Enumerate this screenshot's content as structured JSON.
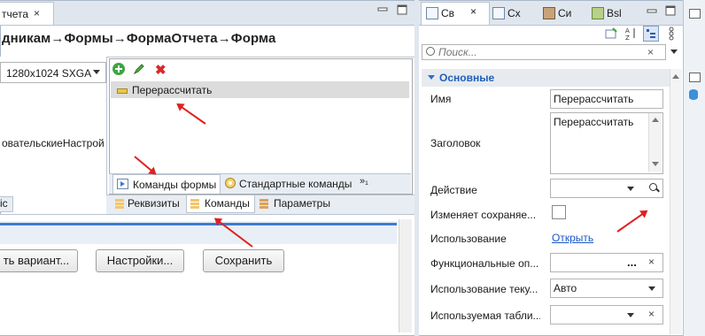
{
  "editor": {
    "tab_label": "тчета",
    "close_glyph": "×",
    "breadcrumb": "дникам→Формы→ФормаОтчета→Форма"
  },
  "preview_panel": {
    "resolution": "1280x1024 SXGA",
    "user_settings_text": "овательскиеНастрой",
    "small_tab": "іс"
  },
  "commands_panel": {
    "toolbar": {
      "add": "add-icon",
      "edit": "edit-icon",
      "delete": "✖"
    },
    "rows": [
      {
        "label": "Перерассчитать"
      }
    ],
    "tabs": {
      "form_commands": "Команды формы",
      "standard_commands": "Стандартные команды",
      "overflow": "»₁"
    }
  },
  "bottom_tabs": {
    "requisites": "Реквизиты",
    "commands": "Команды",
    "params": "Параметры"
  },
  "form_preview": {
    "buttons": {
      "variant": "ть вариант...",
      "settings": "Настройки...",
      "save": "Сохранить"
    }
  },
  "right_panel": {
    "tabs": [
      {
        "label": "Св"
      },
      {
        "label": "Сх"
      },
      {
        "label": "Си"
      },
      {
        "label": "Bsl"
      }
    ],
    "tab_close": "×",
    "search": {
      "placeholder": "Поиск...",
      "clear": "×"
    },
    "group": "Основные",
    "properties": {
      "name_label": "Имя",
      "name_value": "Перерассчитать",
      "title_label": "Заголовок",
      "title_value": "Перерассчитать",
      "action_label": "Действие",
      "changes_saved_label": "Изменяет сохраняе...",
      "usage_label": "Использование",
      "usage_link": "Открыть",
      "func_label": "Функциональные оп...",
      "func_value": "...",
      "func_clear": "×",
      "current_usage_label": "Использование теку...",
      "current_usage_value": "Авто",
      "used_table_label": "Используемая табли...",
      "used_table_clear": "×"
    }
  },
  "colors": {
    "accent": "#1d5fb8",
    "arrow": "#e02020",
    "link": "#1a57c8"
  }
}
